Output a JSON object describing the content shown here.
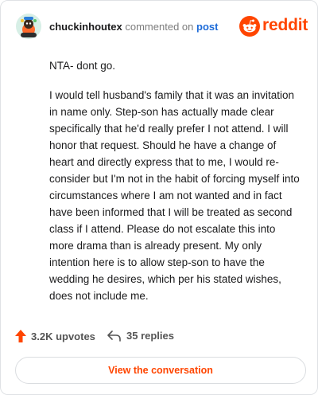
{
  "header": {
    "username": "chuckinhoutex",
    "commented_on": "commented on",
    "post_link": "post",
    "logo_text": "reddit",
    "avatar_icon": "snoo-avatar-icon",
    "logo_icon": "reddit-alien-icon"
  },
  "comment": {
    "paragraphs": [
      "NTA- dont go.",
      "I would tell husband's family that it was an invitation in name only. Step-son has actually made clear specifically that he'd really prefer I not attend. I will honor that request. Should he have a change of heart and directly express that to me, I would re-consider but I'm not in the habit of forcing myself into circumstances where I am not wanted and in fact have been informed that I will be treated as second class if I attend. Please do not escalate this into more drama than is already present. My only intention here is to allow step-son to have the wedding he desires, which per his stated wishes, does not include me."
    ]
  },
  "actions": {
    "upvotes": "3.2K upvotes",
    "replies": "35 replies",
    "upvote_icon": "upvote-arrow-icon",
    "reply_icon": "reply-arrow-icon"
  },
  "footer": {
    "view_button": "View the conversation"
  },
  "colors": {
    "brand": "#ff4500",
    "link": "#1d6bd8",
    "text": "#1a1a1b",
    "muted": "#7c7c7c"
  }
}
